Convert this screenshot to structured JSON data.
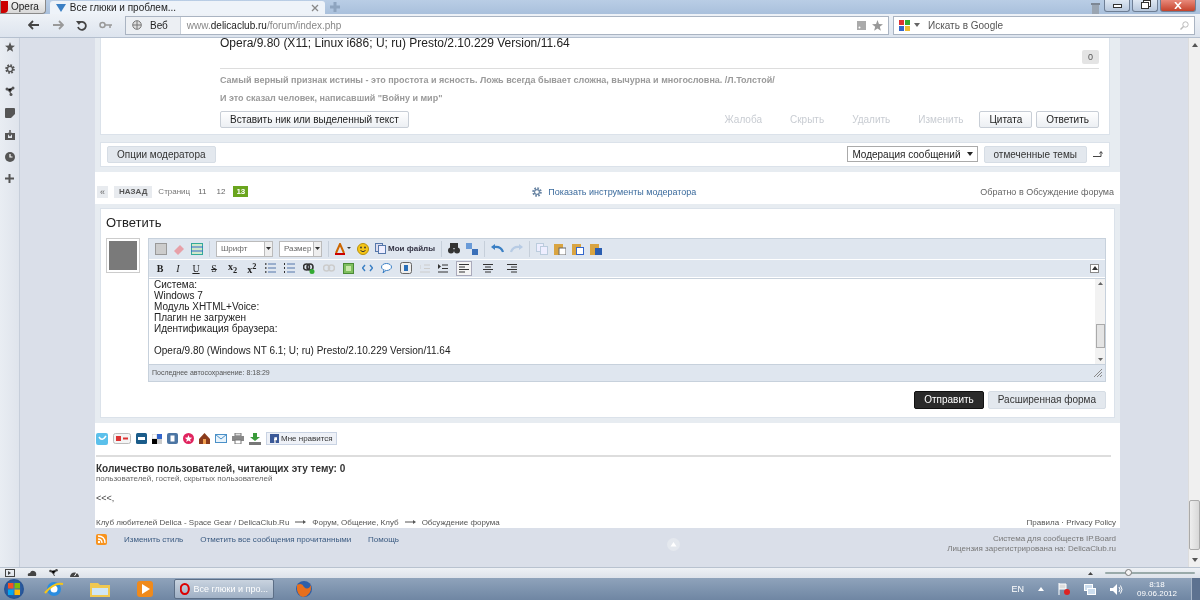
{
  "browser": {
    "menu_button": "Opera",
    "tabs": [
      {
        "title": "Все глюки и проблем...",
        "selected": true
      }
    ],
    "address": {
      "badge": "Веб",
      "url_host": "www.delicaclub.ru",
      "url_path": "/forum/index.php"
    },
    "search": {
      "placeholder": "Искать в Google"
    }
  },
  "post": {
    "agent_line": "Opera/9.80 (X11; Linux i686; U; ru) Presto/2.10.229 Version/11.64",
    "reputation": "0",
    "signature": [
      "Самый верный признак истины - это простота и ясность. Ложь всегда бывает сложна, вычурна и многословна. /Л.Толстой/",
      "И это сказал человек, написавший \"Войну и мир\""
    ],
    "insert_button": "Вставить ник или выделенный текст",
    "actions": [
      {
        "label": "Жалоба",
        "disabled": true
      },
      {
        "label": "Скрыть",
        "disabled": true
      },
      {
        "label": "Удалить",
        "disabled": true
      },
      {
        "label": "Изменить",
        "disabled": true
      },
      {
        "label": "Цитата",
        "disabled": false
      },
      {
        "label": "Ответить",
        "disabled": false
      }
    ]
  },
  "moderation": {
    "options_button": "Опции модератора",
    "select_value": "Модерация сообщений",
    "marked_button": "отмеченные темы"
  },
  "pagination": {
    "prev": "«",
    "back": "НАЗАД",
    "label": "Страниц",
    "pages": [
      {
        "label": "11",
        "selected": false
      },
      {
        "label": "12",
        "selected": false
      },
      {
        "label": "13",
        "selected": true
      }
    ],
    "tools_link": "Показать инструменты модератора",
    "return_link": "Обратно в Обсуждение форума"
  },
  "reply": {
    "title": "Ответить",
    "font_select": "Шрифт",
    "size_select": "Размер",
    "files_button": "Мои файлы",
    "format_buttons": [
      {
        "label": "B",
        "kind": "bold"
      },
      {
        "label": "I",
        "kind": "italic"
      },
      {
        "label": "U",
        "kind": "underline"
      },
      {
        "label": "S",
        "kind": "strike"
      },
      {
        "label": "x$_{2}$",
        "kind": "plain"
      },
      {
        "label": "x$^{2}$",
        "kind": "plain"
      }
    ],
    "align_buttons": [
      {
        "selected": true
      },
      {
        "selected": false
      },
      {
        "selected": false
      }
    ],
    "lines": [
      "Система:",
      "Windows 7",
      "Модуль XHTML+Voice:",
      "Плагин не загружен",
      "Идентификация браузера:"
    ],
    "agent_line": "Opera/9.80 (Windows NT 6.1; U; ru) Presto/2.10.229 Version/11.64",
    "autosave": "Последнее автосохранение: 8:18:29",
    "submit_button": "Отправить",
    "advanced_button": "Расширенная форма"
  },
  "share": {
    "like_button": "Мне нравится"
  },
  "viewers": {
    "title": "Количество пользователей, читающих эту тему: 0",
    "detail": "пользователей, гостей, скрытых пользователей",
    "list": "<<<,"
  },
  "breadcrumb": [
    "Клуб любителей Delica - Space Gear / DelicaClub.Ru",
    "Форум, Общение, Клуб",
    "Обсуждение форума"
  ],
  "legal": "Правила · Privacy Policy",
  "footer": {
    "links": [
      "Изменить стиль",
      "Отметить все сообщения прочитанными",
      "Помощь"
    ],
    "credits": [
      "Система для сообществ IP.Board",
      "Лицензия зарегистрирована на: DelicaClub.ru"
    ]
  },
  "status_bar": {
    "zoom_slider": {
      "level": 0.27
    }
  },
  "taskbar": {
    "tasks": [
      {
        "title": "Все глюки и про...",
        "selected": true
      }
    ],
    "language": "EN",
    "time": "8:18",
    "date": "09.06.2012"
  }
}
